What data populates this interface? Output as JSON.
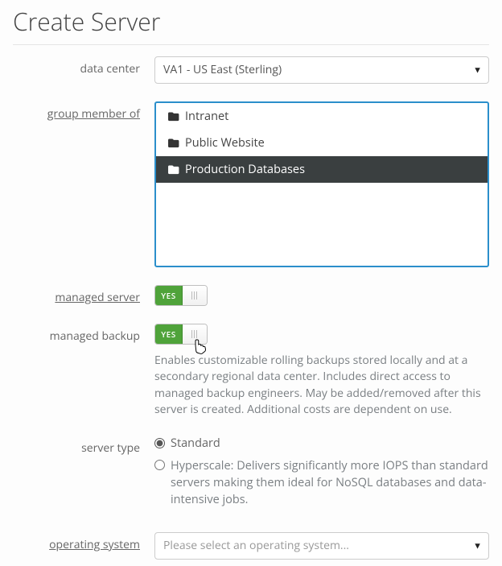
{
  "title": "Create Server",
  "labels": {
    "data_center": "data center",
    "group": "group member of",
    "managed_server": "managed server",
    "managed_backup": "managed backup",
    "server_type": "server type",
    "os": "operating system"
  },
  "data_center": {
    "selected": "VA1 - US East (Sterling)"
  },
  "group": {
    "options": [
      "Intranet",
      "Public Website",
      "Production Databases"
    ],
    "selected_index": 2
  },
  "managed_server": {
    "on_label": "YES",
    "value": true
  },
  "managed_backup": {
    "on_label": "YES",
    "value": true,
    "description": "Enables customizable rolling backups stored locally and at a secondary regional data center. Includes direct access to managed backup engineers. May be added/removed after this server is created. Additional costs are dependent on use."
  },
  "server_type": {
    "options": {
      "standard": {
        "label": "Standard"
      },
      "hyperscale": {
        "label": "Hyperscale:",
        "desc": "Delivers significantly more IOPS than standard servers making them ideal for NoSQL databases and data-intensive jobs."
      }
    },
    "selected": "standard"
  },
  "os": {
    "placeholder": "Please select an operating system..."
  }
}
